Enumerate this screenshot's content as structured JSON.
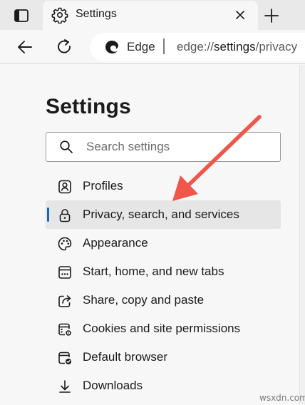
{
  "tab": {
    "title": "Settings"
  },
  "toolbar": {
    "site_name": "Edge",
    "url_prefix": "edge://",
    "url_main": "settings",
    "url_suffix": "/privacy"
  },
  "page": {
    "title": "Settings",
    "search": {
      "placeholder": "Search settings",
      "value": ""
    }
  },
  "nav": {
    "items": [
      {
        "label": "Profiles",
        "icon": "profile-icon"
      },
      {
        "label": "Privacy, search, and services",
        "icon": "lock-icon",
        "active": true
      },
      {
        "label": "Appearance",
        "icon": "palette-icon"
      },
      {
        "label": "Start, home, and new tabs",
        "icon": "start-page-icon"
      },
      {
        "label": "Share, copy and paste",
        "icon": "share-icon"
      },
      {
        "label": "Cookies and site permissions",
        "icon": "cookies-permissions-icon"
      },
      {
        "label": "Default browser",
        "icon": "default-browser-icon"
      },
      {
        "label": "Downloads",
        "icon": "download-icon"
      }
    ]
  },
  "colors": {
    "accent": "#0f6cbd",
    "arrow": "#f0564a",
    "active_bg": "#e6e6e6"
  },
  "watermark": "wsxdn.com"
}
